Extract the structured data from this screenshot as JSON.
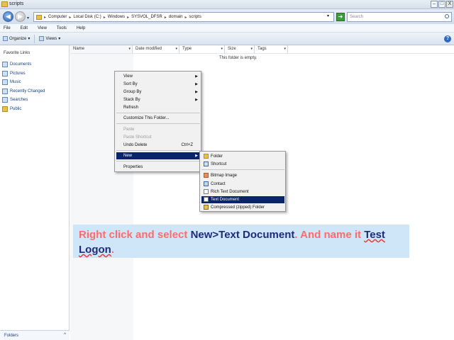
{
  "window": {
    "title": "scripts",
    "controls": {
      "minimize": "–",
      "maximize": "□",
      "close": "X"
    }
  },
  "address": {
    "crumbs": [
      "Computer",
      "Local Disk (C:)",
      "Windows",
      "SYSVOL_DFSR",
      "domain",
      "scripts"
    ],
    "search_placeholder": "Search"
  },
  "menubar": [
    "File",
    "Edit",
    "View",
    "Tools",
    "Help"
  ],
  "commandbar": {
    "organize": "Organize",
    "views": "Views"
  },
  "navpane": {
    "title": "Favorite Links",
    "items": [
      "Documents",
      "Pictures",
      "Music",
      "Recently Changed",
      "Searches",
      "Public"
    ],
    "folders_label": "Folders"
  },
  "columns": [
    "Name",
    "Date modified",
    "Type",
    "Size",
    "Tags"
  ],
  "empty_message": "This folder is empty.",
  "context_menu": {
    "items": [
      {
        "label": "View",
        "submenu": true,
        "enabled": true
      },
      {
        "label": "Sort By",
        "submenu": true,
        "enabled": true
      },
      {
        "label": "Group By",
        "submenu": true,
        "enabled": true
      },
      {
        "label": "Stack By",
        "submenu": true,
        "enabled": true
      },
      {
        "label": "Refresh",
        "submenu": false,
        "enabled": true
      },
      {
        "label": "Customize This Folder...",
        "submenu": false,
        "enabled": true
      },
      {
        "label": "Paste",
        "submenu": false,
        "enabled": false
      },
      {
        "label": "Paste Shortcut",
        "submenu": false,
        "enabled": false
      },
      {
        "label": "Undo Delete",
        "shortcut": "Ctrl+Z",
        "submenu": false,
        "enabled": true
      },
      {
        "label": "New",
        "submenu": true,
        "enabled": true,
        "highlighted": true
      },
      {
        "label": "Properties",
        "submenu": false,
        "enabled": true
      }
    ]
  },
  "new_submenu": {
    "items": [
      {
        "label": "Folder",
        "icon": "folder-icon"
      },
      {
        "label": "Shortcut",
        "icon": "shortcut-icon"
      },
      {
        "label": "Bitmap Image",
        "icon": "bitmap-icon"
      },
      {
        "label": "Contact",
        "icon": "contact-icon"
      },
      {
        "label": "Rich Text Document",
        "icon": "rtf-icon"
      },
      {
        "label": "Text Document",
        "icon": "text-document-icon",
        "highlighted": true
      },
      {
        "label": "Compressed (zipped) Folder",
        "icon": "zip-folder-icon"
      }
    ]
  },
  "instruction": {
    "part1": "Right click and select ",
    "part2": "New>Text Document",
    "part3": ". And name it ",
    "part4": "Test Logon",
    "part5": "."
  },
  "colors": {
    "menu_highlight": "#0a246a",
    "instruction_bg": "#cfe6f9",
    "instruction_red": "#ff6b6b",
    "instruction_navy": "#1f2a7c"
  }
}
